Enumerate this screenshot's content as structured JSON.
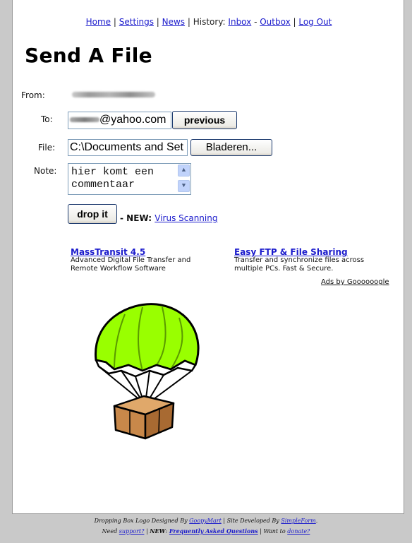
{
  "nav": {
    "home": "Home",
    "sep1": " | ",
    "settings": "Settings",
    "sep2": " | ",
    "news": "News",
    "history_label": " | History: ",
    "inbox": "Inbox",
    "dash": " - ",
    "outbox": "Outbox",
    "sep3": " | ",
    "logout": "Log Out"
  },
  "page_title": "Send A File",
  "form": {
    "from_label": "From:",
    "to_label": "To:",
    "to_value": "@yahoo.com",
    "previous_button": "previous",
    "file_label": "File:",
    "file_value": "C:\\Documents and Set",
    "browse_button": "Bladeren...",
    "note_label": "Note:",
    "note_value": "hier komt een commentaar",
    "submit_button": "drop it",
    "new_prefix": " - NEW: ",
    "virus_link": "Virus Scanning"
  },
  "ads": [
    {
      "title": "MassTransit 4.5",
      "line1": "Advanced Digital File Transfer and",
      "line2": "Remote Workflow Software"
    },
    {
      "title": "Easy FTP & File Sharing",
      "line1": "Transfer and synchronize files across",
      "line2": "multiple PCs. Fast & Secure."
    }
  ],
  "ads_by": "Ads by Goooooogle",
  "footer": {
    "line1_a": "Dropping Box Logo Designed By ",
    "goopymart": "GoopyMart",
    "line1_b": " | Site Developed By ",
    "simpleform": "SimpleForm",
    "line1_c": ".",
    "line2_a": "Need ",
    "support": "support?",
    "line2_b": " | ",
    "new_label": "NEW",
    "line2_c": ": ",
    "faq": "Frequently Asked Questions",
    "line2_d": " | Want to ",
    "donate": "donate?"
  },
  "icons": {
    "scroll_up": "chevron-up-icon",
    "scroll_down": "chevron-down-icon",
    "logo": "parachute-box-icon"
  },
  "colors": {
    "link": "#1a1acc",
    "parachute": "#99ff00",
    "box": "#c8884a",
    "background": "#c9c9c9"
  }
}
